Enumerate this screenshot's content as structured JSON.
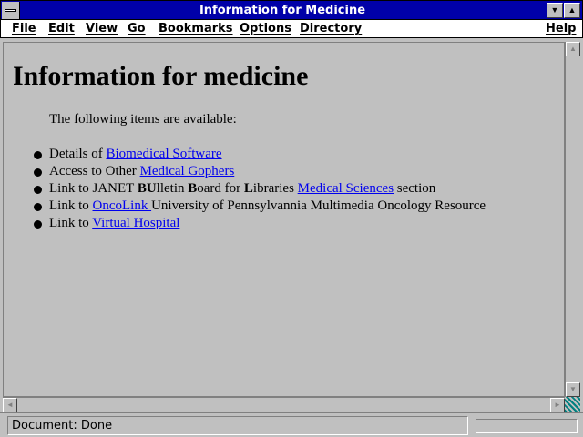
{
  "window": {
    "title": "Information for Medicine",
    "minimize_glyph": "▼",
    "maximize_glyph": "▲"
  },
  "menubar": {
    "items": [
      "File",
      "Edit",
      "View",
      "Go",
      "Bookmarks",
      "Options",
      "Directory"
    ],
    "help": "Help"
  },
  "content": {
    "heading": "Information for medicine",
    "intro": "The following items are available:",
    "items": [
      {
        "prefix": "Details of ",
        "link": "Biomedical Software ",
        "suffix": ""
      },
      {
        "prefix": "Access to Other ",
        "link": "Medical Gophers ",
        "suffix": ""
      },
      {
        "prefix": "Link to JANET ",
        "b1": "BU",
        "t1": "lletin ",
        "b2": "B",
        "t2": "oard for ",
        "b3": "L",
        "t3": "ibraries ",
        "link": "Medical Sciences",
        "suffix": " section"
      },
      {
        "prefix": "Link to ",
        "link": "OncoLink ",
        "suffix": "University of Pennsylvannia Multimedia Oncology Resource"
      },
      {
        "prefix": "Link to ",
        "link": "Virtual Hospital ",
        "suffix": ""
      }
    ]
  },
  "scrollbars": {
    "up": "▲",
    "down": "▼",
    "left": "◄",
    "right": "►"
  },
  "statusbar": {
    "text": "Document: Done"
  },
  "colors": {
    "titlebar": "#0000a8",
    "link": "#0000ee",
    "background": "#c0c0c0"
  }
}
